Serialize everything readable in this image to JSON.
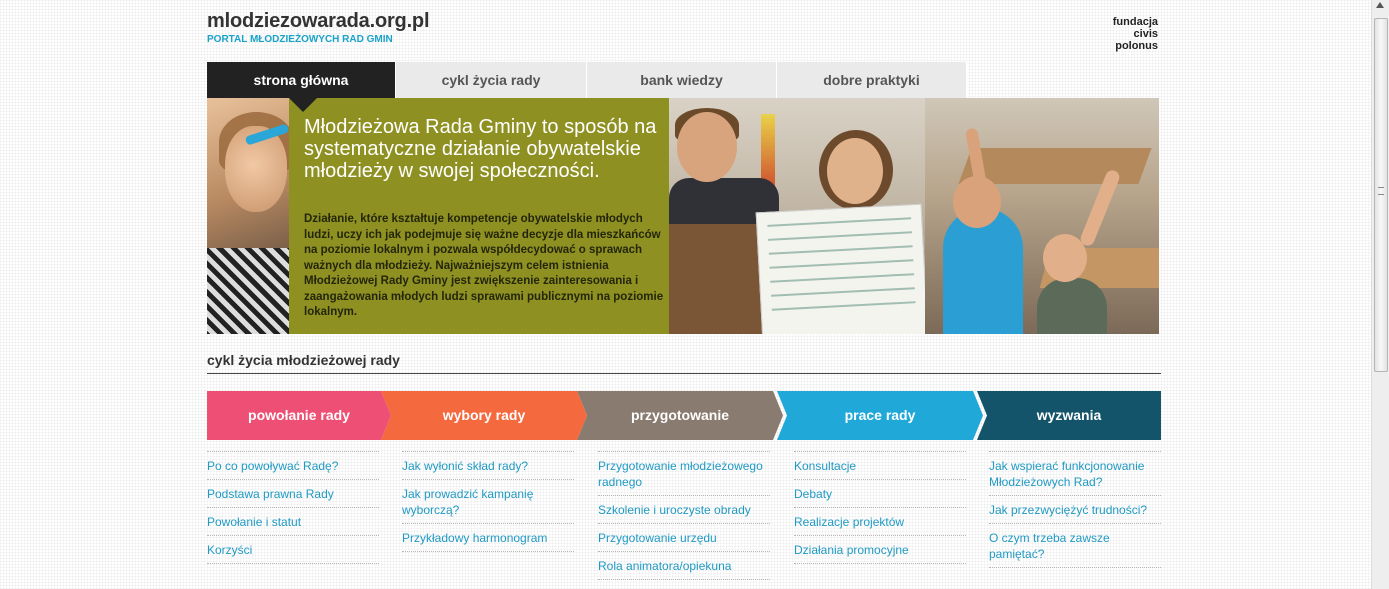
{
  "header": {
    "site_title": "mlodziezowarada.org.pl",
    "site_subtitle": "PORTAL MŁODZIEŻOWYCH RAD GMIN",
    "foundation": [
      "fundacja",
      "civis",
      "polonus"
    ]
  },
  "nav": {
    "tabs": [
      {
        "label": "strona główna",
        "active": true
      },
      {
        "label": "cykl życia rady",
        "active": false
      },
      {
        "label": "bank wiedzy",
        "active": false
      },
      {
        "label": "dobre praktyki",
        "active": false
      }
    ]
  },
  "hero": {
    "heading": "Młodzieżowa Rada Gminy to sposób na systematyczne działanie obywatelskie młodzieży w swojej społeczności.",
    "body": "Działanie, które kształtuje kompetencje obywatelskie młodych ludzi, uczy ich jak podejmuje się ważne decyzje dla mieszkańców na poziomie lokalnym i pozwala współdecydować o sprawach ważnych dla młodzieży. Najważniejszym celem istnienia Młodzieżowej Rady Gminy jest zwiększenie zainteresowania i zaangażowania młodych ludzi sprawami publicznymi na poziomie lokalnym.",
    "colors": {
      "panel": "#8f9022"
    }
  },
  "lifecycle": {
    "title": "cykl życia młodzieżowej rady",
    "stages": [
      {
        "label": "powołanie rady",
        "color": "#ee4f74",
        "links": [
          "Po co powoływać Radę?",
          "Podstawa prawna Rady",
          "Powołanie i statut",
          "Korzyści"
        ]
      },
      {
        "label": "wybory rady",
        "color": "#f4693e",
        "links": [
          "Jak wyłonić skład rady?",
          "Jak prowadzić kampanię wyborczą?",
          "Przykładowy harmonogram"
        ]
      },
      {
        "label": "przygotowanie",
        "color": "#8a7b70",
        "links": [
          "Przygotowanie młodzieżowego radnego",
          "Szkolenie i uroczyste obrady",
          "Przygotowanie urzędu",
          "Rola animatora/opiekuna"
        ]
      },
      {
        "label": "prace rady",
        "color": "#1fa8d8",
        "links": [
          "Konsultacje",
          "Debaty",
          "Realizacje projektów",
          "Działania promocyjne"
        ]
      },
      {
        "label": "wyzwania",
        "color": "#13546b",
        "links": [
          "Jak wspierać funkcjonowanie Młodzieżowych Rad?",
          "Jak przezwyciężyć trudności?",
          "O czym trzeba zawsze pamiętać?"
        ]
      }
    ]
  }
}
